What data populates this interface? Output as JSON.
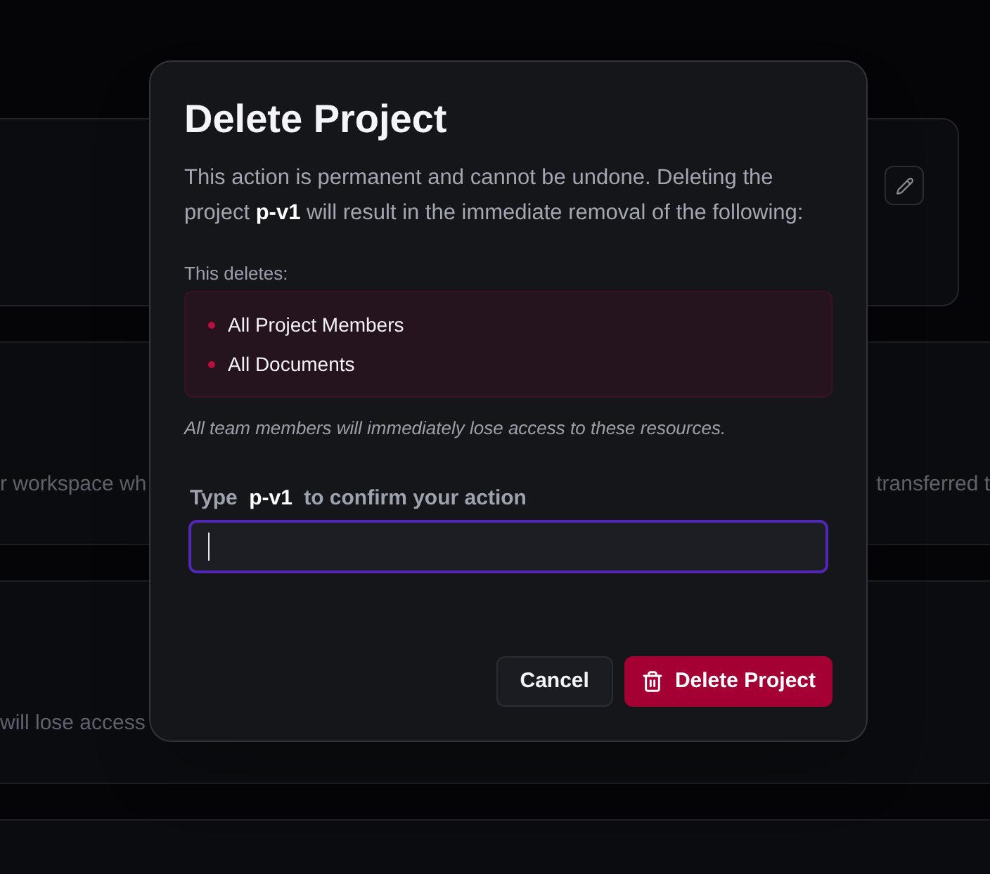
{
  "background": {
    "sections": [
      {
        "left_text": "r workspace wh",
        "right_text": "transferred t"
      },
      {
        "left_text": "will lose access"
      }
    ]
  },
  "dialog": {
    "title": "Delete Project",
    "description": "This action is permanent and cannot be undone. Deleting the project **p-v1** will result in the immediate removal of the following:",
    "deletes_label": "This deletes:",
    "deleted_items": [
      "All Project Members",
      "All Documents"
    ],
    "note": "All team members will immediately lose access to these resources.",
    "confirm": {
      "label": "Type **p-v1** to confirm your action",
      "focused": true
    },
    "buttons": [
      {
        "label": "Cancel",
        "kind": "secondary"
      },
      {
        "label": "Delete Project",
        "kind": "danger"
      }
    ]
  }
}
